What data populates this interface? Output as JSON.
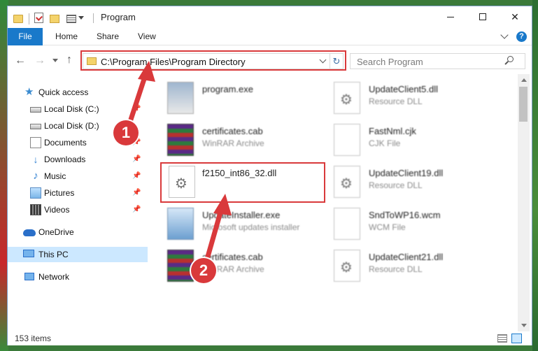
{
  "window": {
    "title": "Program",
    "controls": {
      "minimize": "—",
      "maximize": "☐",
      "close": "✕"
    }
  },
  "ribbon": {
    "tabs": [
      "File",
      "Home",
      "Share",
      "View"
    ],
    "help": "?"
  },
  "nav": {
    "back": "←",
    "forward": "→",
    "up": "↑",
    "refresh": "↻",
    "address": "C:\\Program Files\\Program Directory",
    "search_placeholder": "Search Program"
  },
  "sidebar": {
    "items": [
      {
        "label": "Quick access",
        "icon": "star-icon"
      },
      {
        "label": "Local Disk (C:)",
        "icon": "drive-icon",
        "pinned": true
      },
      {
        "label": "Local Disk (D:)",
        "icon": "drive-icon",
        "pinned": true
      },
      {
        "label": "Documents",
        "icon": "documents-icon",
        "pinned": true
      },
      {
        "label": "Downloads",
        "icon": "download-icon",
        "pinned": true
      },
      {
        "label": "Music",
        "icon": "music-icon",
        "pinned": true
      },
      {
        "label": "Pictures",
        "icon": "pictures-icon",
        "pinned": true
      },
      {
        "label": "Videos",
        "icon": "videos-icon",
        "pinned": true
      },
      {
        "label": "OneDrive",
        "icon": "cloud-icon"
      },
      {
        "label": "This PC",
        "icon": "computer-icon",
        "selected": true
      },
      {
        "label": "Network",
        "icon": "network-icon"
      }
    ],
    "pin_glyph": "📌"
  },
  "files": {
    "items": [
      {
        "name": "program.exe",
        "type": "",
        "icon": "exe-icon"
      },
      {
        "name": "UpdateClient5.dll",
        "type": "Resource DLL",
        "icon": "dll-icon"
      },
      {
        "name": "certificates.cab",
        "type": "WinRAR Archive",
        "icon": "archive-icon"
      },
      {
        "name": "FastNml.cjk",
        "type": "CJK File",
        "icon": "file-icon"
      },
      {
        "name": "f2150_int86_32.dll",
        "type": "",
        "icon": "dll-icon"
      },
      {
        "name": "UpdateClient19.dll",
        "type": "Resource DLL",
        "icon": "dll-icon"
      },
      {
        "name": "UpdateInstaller.exe",
        "type": "Microsoft updates installer",
        "icon": "installer-icon"
      },
      {
        "name": "SndToWP16.wcm",
        "type": "WCM File",
        "icon": "file-icon"
      },
      {
        "name": "certificates.cab",
        "type": "WinRAR Archive",
        "icon": "archive-icon"
      },
      {
        "name": "UpdateClient21.dll",
        "type": "Resource DLL",
        "icon": "dll-icon"
      }
    ]
  },
  "callouts": {
    "one": "1",
    "two": "2"
  },
  "status": {
    "count": "153 items"
  },
  "colors": {
    "accent": "#1979ca",
    "highlight": "#d9393b",
    "selection": "#cce8ff"
  }
}
